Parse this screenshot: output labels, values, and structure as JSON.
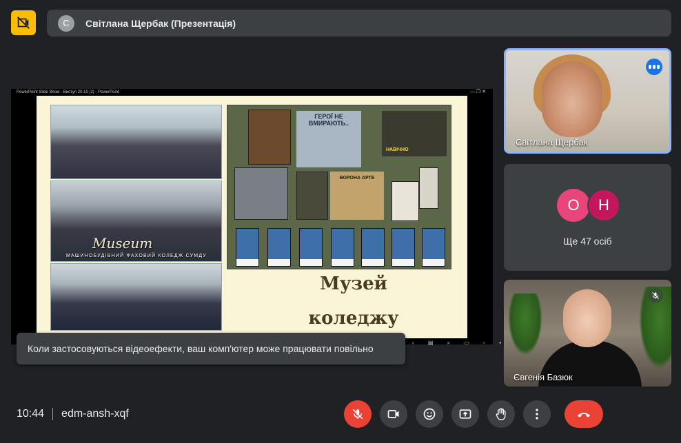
{
  "presenter_bar": {
    "avatar_initial": "С",
    "text": "Світлана Щербак (Презентація)"
  },
  "shared_window": {
    "title": "PowerPoint Slide Show - Виступ 20.10 (2) - PowerPoint",
    "window_controls": "— ❐ ✕"
  },
  "slide": {
    "museum_word": "Museum",
    "museum_subtitle": "МАШИНОБУДІВНИЙ ФАХОВИЙ КОЛЕДЖ СУМДУ",
    "heroes_text": "ГЕРОЇ НЕ ВМИРАЮТЬ..",
    "navichno_text": "НАВІЧНО",
    "vorona_text": "ВОРОНА АРТЕ",
    "title_line1": "Музей",
    "title_line2": "коледжу"
  },
  "toast": {
    "message": "Коли застосовуються відеоефекти, ваш комп'ютер може працювати повільно"
  },
  "participants": [
    {
      "name": "Світлана Щербак",
      "speaking": true
    },
    {
      "initials": [
        "О",
        "Н"
      ],
      "more_label": "Ще 47 осіб"
    },
    {
      "name": "Євгенія Базюк",
      "muted": true
    }
  ],
  "bottom_bar": {
    "time": "10:44",
    "meeting_code": "edm-ansh-xqf"
  },
  "colors": {
    "accent_yellow": "#fbbc04",
    "active_border": "#8ab4f8",
    "end_call": "#ea4335"
  }
}
